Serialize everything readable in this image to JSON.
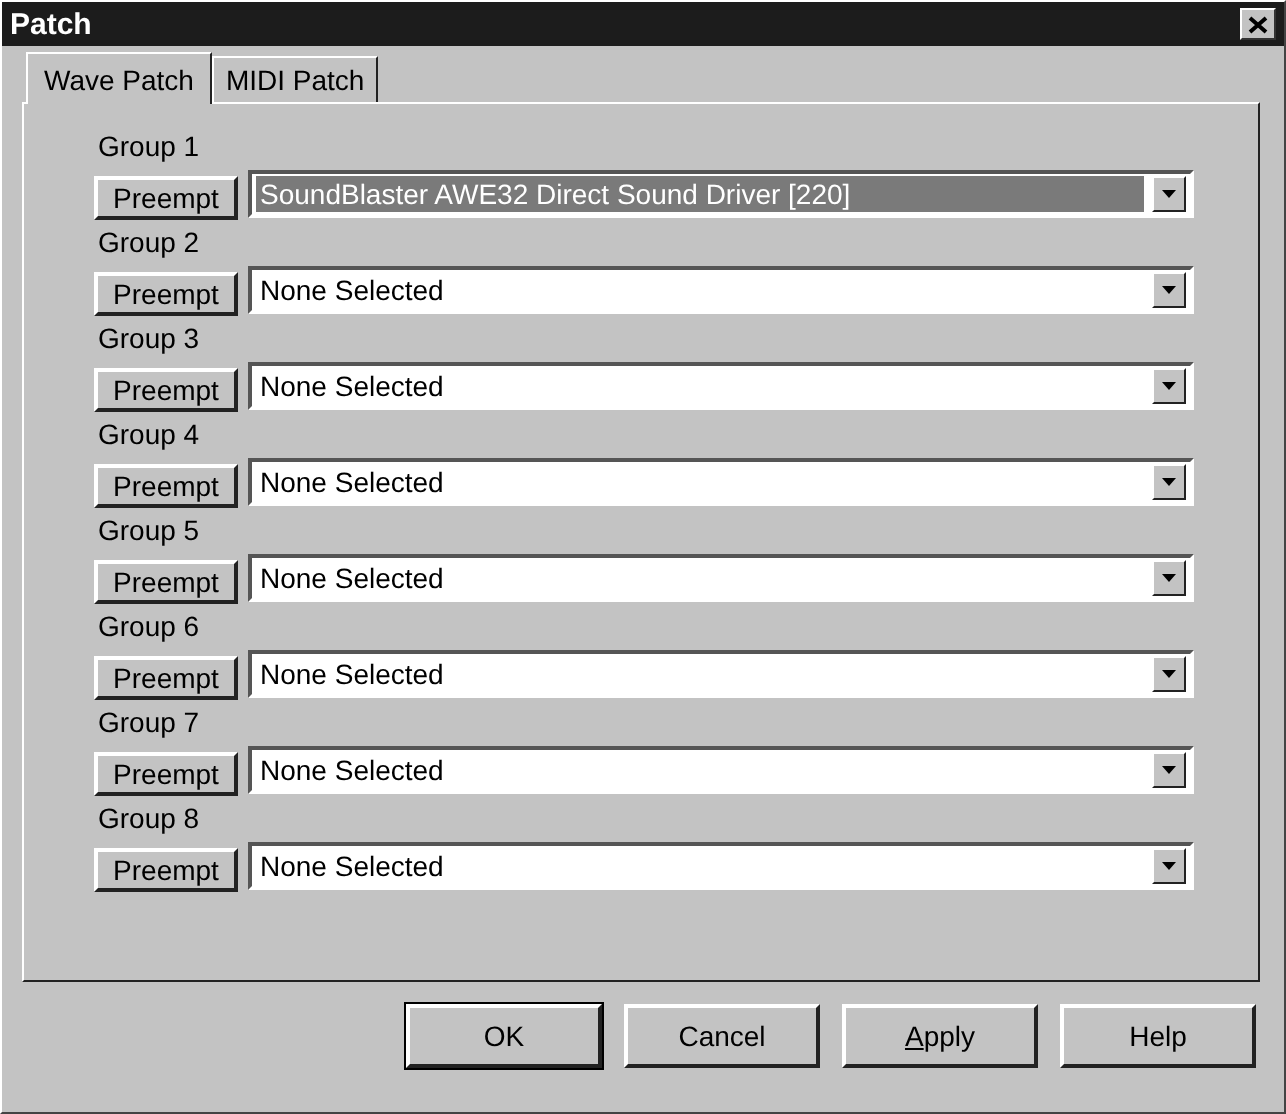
{
  "window": {
    "title": "Patch"
  },
  "tabs": [
    {
      "label": "Wave Patch",
      "selected": true
    },
    {
      "label": "MIDI Patch",
      "selected": false
    }
  ],
  "groups": [
    {
      "label": "Group 1",
      "button": "Preempt",
      "value": "SoundBlaster AWE32 Direct Sound Driver [220]",
      "focused": true
    },
    {
      "label": "Group 2",
      "button": "Preempt",
      "value": "None Selected",
      "focused": false
    },
    {
      "label": "Group 3",
      "button": "Preempt",
      "value": "None Selected",
      "focused": false
    },
    {
      "label": "Group 4",
      "button": "Preempt",
      "value": "None Selected",
      "focused": false
    },
    {
      "label": "Group 5",
      "button": "Preempt",
      "value": "None Selected",
      "focused": false
    },
    {
      "label": "Group 6",
      "button": "Preempt",
      "value": "None Selected",
      "focused": false
    },
    {
      "label": "Group 7",
      "button": "Preempt",
      "value": "None Selected",
      "focused": false
    },
    {
      "label": "Group 8",
      "button": "Preempt",
      "value": "None Selected",
      "focused": false
    }
  ],
  "buttons": [
    {
      "label": "OK",
      "default": true,
      "mnemonic": false
    },
    {
      "label": "Cancel",
      "default": false,
      "mnemonic": false
    },
    {
      "label": "Apply",
      "default": false,
      "mnemonic": true
    },
    {
      "label": "Help",
      "default": false,
      "mnemonic": false
    }
  ]
}
